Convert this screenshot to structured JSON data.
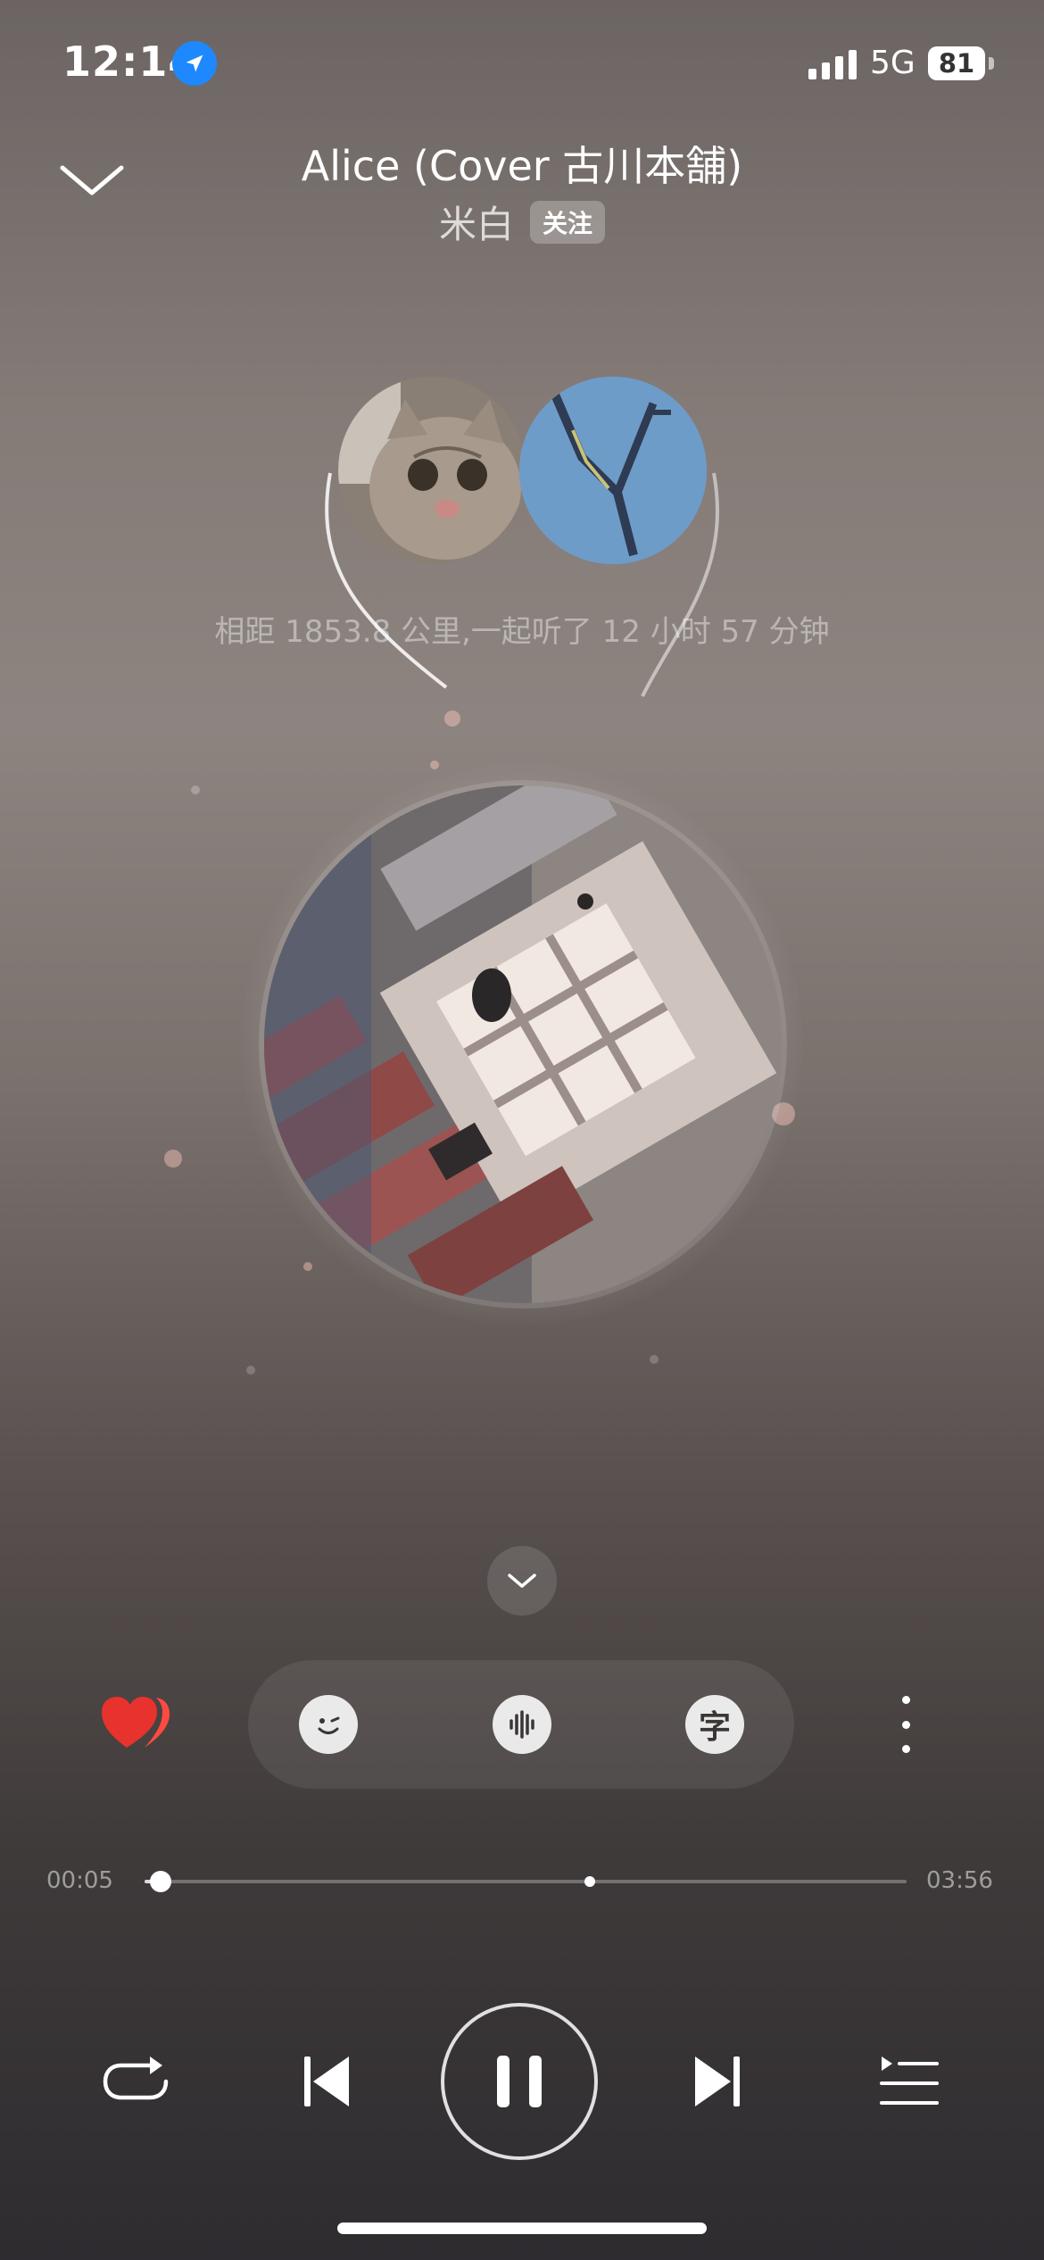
{
  "status": {
    "time": "12:14",
    "network": "5G",
    "battery": "81"
  },
  "song": {
    "title": "Alice (Cover 古川本舗)",
    "artist": "米白",
    "follow_label": "关注"
  },
  "listen_together": {
    "distance_text": "相距 1853.8 公里,一起听了 12 小时 57 分钟"
  },
  "playback": {
    "current_time": "00:05",
    "total_time": "03:56",
    "progress": 0.021
  },
  "icons": {
    "collapse": "chevron-down-icon",
    "like": "heart-icon",
    "effects": "emoji-wink-icon",
    "sound": "sound-wave-icon",
    "lyrics": "lyrics-icon",
    "lyrics_glyph": "字",
    "more": "more-vertical-icon",
    "repeat": "repeat-icon",
    "prev": "skip-previous-icon",
    "pause": "pause-icon",
    "next": "skip-next-icon",
    "playlist": "playlist-icon"
  },
  "colors": {
    "like": "#e8322e",
    "location": "#1e88ff"
  }
}
